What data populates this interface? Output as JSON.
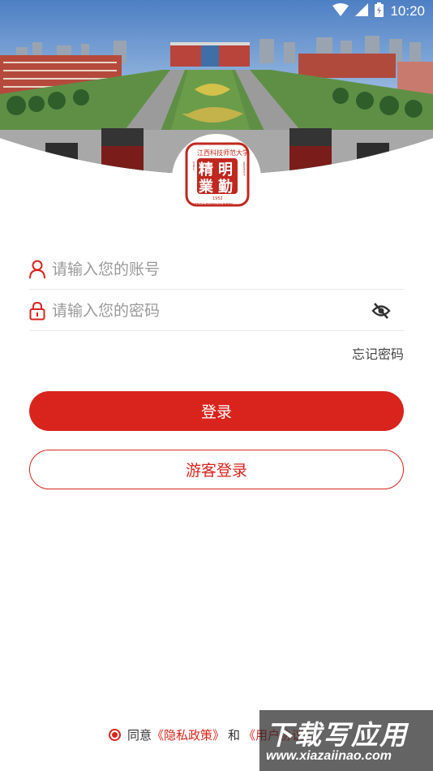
{
  "status_bar": {
    "time": "10:20"
  },
  "logo": {
    "glyphs": [
      "精",
      "明",
      "業",
      "勤"
    ],
    "year": "1952",
    "arc_text": "江西科技师范大学",
    "side_text_left": "JIANGXI",
    "side_text_bottom": "SCIENCE & TECHNOLOGY NORMAL",
    "side_text_right": "UNIVERSITY"
  },
  "form": {
    "account": {
      "placeholder": "请输入您的账号",
      "value": ""
    },
    "password": {
      "placeholder": "请输入您的密码",
      "value": ""
    },
    "forgot_label": "忘记密码"
  },
  "buttons": {
    "login": "登录",
    "guest": "游客登录"
  },
  "agreement": {
    "prefix": "同意",
    "privacy_link": "《隐私政策》",
    "conj": "和",
    "terms_link": "《用户协议》"
  },
  "watermark": {
    "title": "下载写应用",
    "url": "www.xiazaiinao.com"
  },
  "colors": {
    "primary": "#d8241d",
    "text": "#333333",
    "placeholder": "#9a9a9a",
    "divider": "#e8e8e8"
  },
  "icons": [
    "wifi-icon",
    "signal-icon",
    "battery-icon",
    "user-icon",
    "lock-icon",
    "eye-off-icon"
  ]
}
